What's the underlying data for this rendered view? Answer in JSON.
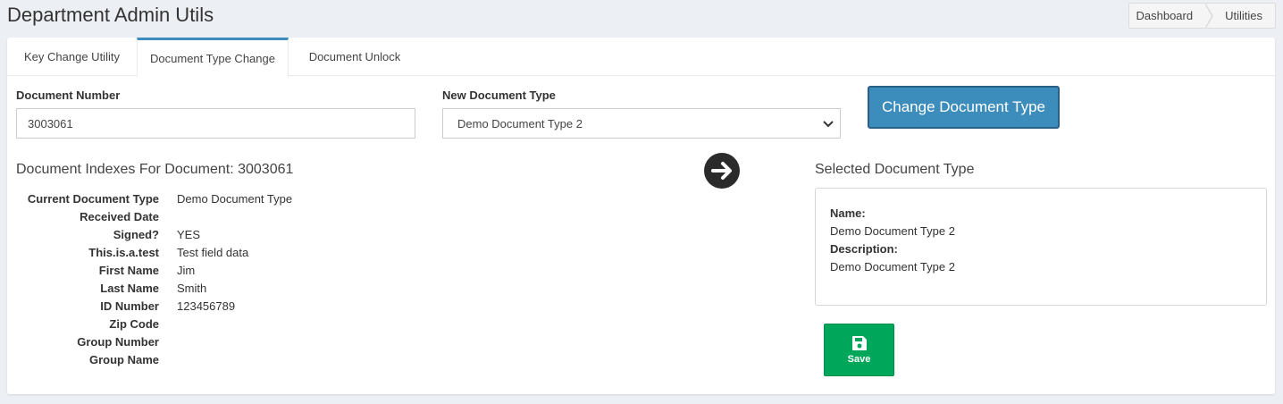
{
  "header": {
    "title": "Department Admin Utils",
    "breadcrumb": [
      "Dashboard",
      "Utilities"
    ]
  },
  "tabs": [
    {
      "label": "Key Change Utility",
      "active": false
    },
    {
      "label": "Document Type Change",
      "active": true
    },
    {
      "label": "Document Unlock",
      "active": false
    }
  ],
  "form": {
    "document_number_label": "Document Number",
    "document_number_value": "3003061",
    "new_type_label": "New Document Type",
    "new_type_selected": "Demo Document Type 2",
    "change_button": "Change Document Type"
  },
  "indexes": {
    "title": "Document Indexes For Document: 3003061",
    "fields": [
      {
        "key": "Current Document Type",
        "value": "Demo Document Type"
      },
      {
        "key": "Received Date",
        "value": ""
      },
      {
        "key": "Signed?",
        "value": "YES"
      },
      {
        "key": "This.is.a.test",
        "value": "Test field data"
      },
      {
        "key": "First Name",
        "value": "Jim"
      },
      {
        "key": "Last Name",
        "value": "Smith"
      },
      {
        "key": "ID Number",
        "value": "123456789"
      },
      {
        "key": "Zip Code",
        "value": ""
      },
      {
        "key": "Group Number",
        "value": ""
      },
      {
        "key": "Group Name",
        "value": ""
      }
    ]
  },
  "selected": {
    "title": "Selected Document Type",
    "name_label": "Name:",
    "name_value": "Demo Document Type 2",
    "desc_label": "Description:",
    "desc_value": "Demo Document Type 2",
    "save_label": "Save"
  },
  "colors": {
    "primary": "#3c8dbc",
    "success": "#00a65a",
    "background": "#eceff3"
  },
  "icons": {
    "arrow": "arrow-right-circle-icon",
    "save": "floppy-disk-icon",
    "select": "chevron-down-icon"
  }
}
